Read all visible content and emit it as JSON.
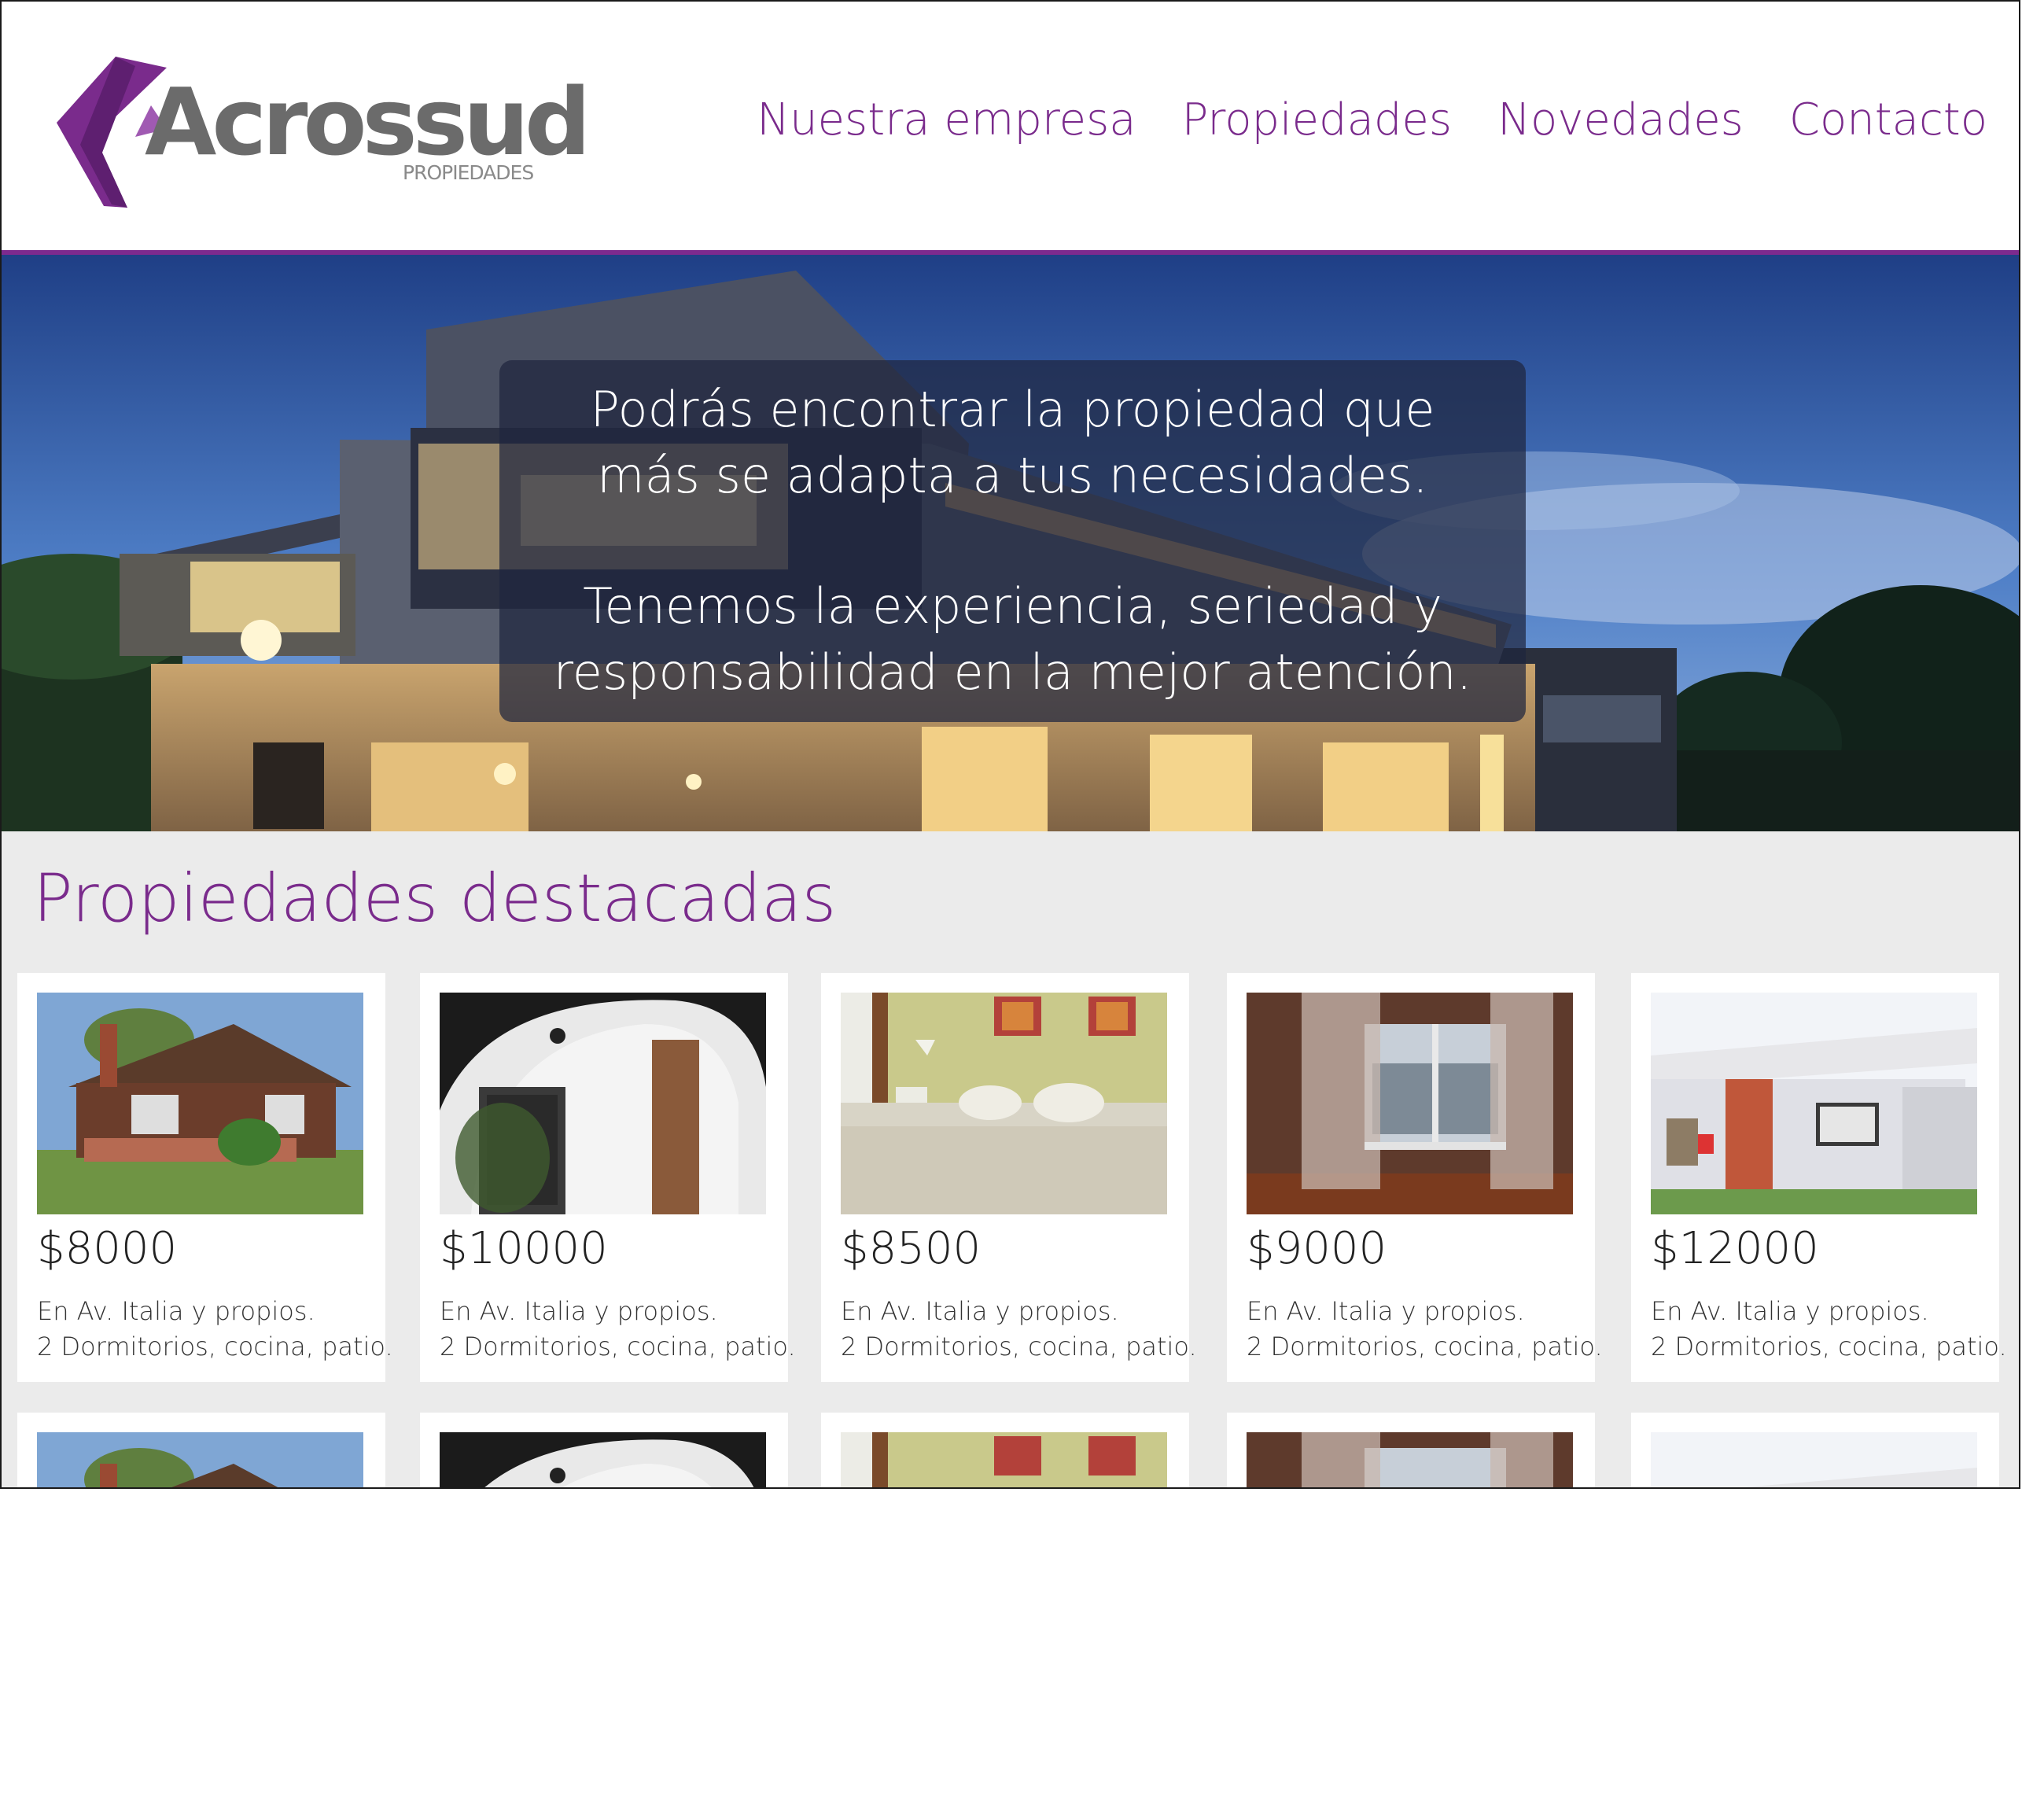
{
  "brand": {
    "name": "Acrossud",
    "subtitle": "PROPIEDADES"
  },
  "nav": [
    "Nuestra empresa",
    "Propiedades",
    "Novedades",
    "Contacto"
  ],
  "colors": {
    "accent": "#7a2b8c",
    "logo_grey": "#6b6b6b",
    "content_bg": "#ebebeb"
  },
  "hero": {
    "line1": "Podrás encontrar la propiedad que más se adapta a tus necesidades.",
    "line2": "Tenemos la experiencia, seriedad y responsabilidad en la mejor atención."
  },
  "featured": {
    "title": "Propiedades destacadas",
    "cards": [
      {
        "price": "$8000",
        "line1": "En Av. Italia y propios.",
        "line2": "2 Dormitorios, cocina, patio.",
        "photo": "brick-house-photo"
      },
      {
        "price": "$10000",
        "line1": "En Av. Italia y propios.",
        "line2": "2 Dormitorios, cocina, patio.",
        "photo": "arched-entry-photo"
      },
      {
        "price": "$8500",
        "line1": "En Av. Italia y propios.",
        "line2": "2 Dormitorios, cocina, patio.",
        "photo": "bedroom-photo"
      },
      {
        "price": "$9000",
        "line1": "En Av. Italia y propios.",
        "line2": "2 Dormitorios, cocina, patio.",
        "photo": "window-curtains-photo"
      },
      {
        "price": "$12000",
        "line1": "En Av. Italia y propios.",
        "line2": "2 Dormitorios, cocina, patio.",
        "photo": "white-house-photo"
      }
    ]
  }
}
